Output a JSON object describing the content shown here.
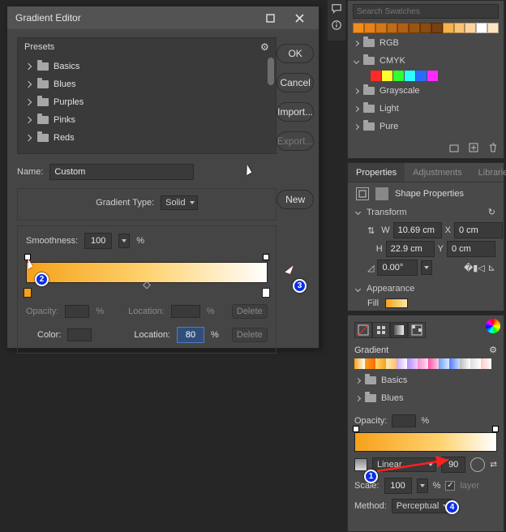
{
  "dialog": {
    "title": "Gradient Editor",
    "presets_label": "Presets",
    "preset_folders": [
      "Basics",
      "Blues",
      "Purples",
      "Pinks",
      "Reds"
    ],
    "buttons": {
      "ok": "OK",
      "cancel": "Cancel",
      "import": "Import...",
      "export": "Export...",
      "new": "New"
    },
    "name_label": "Name:",
    "name_value": "Custom",
    "gradient_type_label": "Gradient Type:",
    "gradient_type_value": "Solid",
    "smoothness_label": "Smoothness:",
    "smoothness_value": "100",
    "percent": "%",
    "stops": {
      "opacity_label": "Opacity:",
      "location_label": "Location:",
      "color_label": "Color:",
      "location_value": "80",
      "delete_label": "Delete"
    }
  },
  "swatches": {
    "search_placeholder": "Search Swatches",
    "top_colors": [
      "#f28c1b",
      "#e68219",
      "#d47717",
      "#c06b15",
      "#ae6013",
      "#9b5511",
      "#8a4b10",
      "#78400e",
      "#f7b24c",
      "#fac374",
      "#fdd59b",
      "#fff",
      "#ffe6c2"
    ],
    "folders": {
      "rgb": "RGB",
      "cmyk": "CMYK",
      "grayscale": "Grayscale",
      "light": "Light",
      "pure": "Pure"
    },
    "cmyk_colors": [
      "#ff2a2a",
      "#ffff2a",
      "#2fff2f",
      "#2affff",
      "#2a6bff",
      "#ff2aff"
    ]
  },
  "properties": {
    "tabs": [
      "Properties",
      "Adjustments",
      "Libraries"
    ],
    "shape_properties": "Shape Properties",
    "transform_label": "Transform",
    "w_label": "W",
    "w_value": "10.69 cm",
    "h_label": "H",
    "h_value": "22.9 cm",
    "x_label": "X",
    "x_value": "0 cm",
    "y_label": "Y",
    "y_value": "0 cm",
    "angle_value": "0.00°",
    "appearance_label": "Appearance",
    "fill_label": "Fill"
  },
  "gradient_panel": {
    "label": "Gradient",
    "preset_gradients": [
      "linear-gradient(to right,#f6a11a,#fff)",
      "linear-gradient(to right,#f6a11a,#ff6a00)",
      "linear-gradient(to right,#ffd86f,#f6a11a)",
      "linear-gradient(to right,#ffe8b8,#ffc562)",
      "linear-gradient(to right,#cfa3ff,#fff)",
      "linear-gradient(to right,#b08cff,#f0d0ff)",
      "linear-gradient(to right,#ff8ad1,#ffe0f2)",
      "linear-gradient(to right,#ff4fa3,#ffd0e8)",
      "linear-gradient(to right,#6aa3ff,#dce9ff)",
      "linear-gradient(to right,#4f7dff,#cddcff)",
      "linear-gradient(to right,#bbb,#fff)",
      "linear-gradient(to right,#ddd,#fff)",
      "linear-gradient(to right,#ffc9c0,#fff)"
    ],
    "folders": [
      "Basics",
      "Blues"
    ],
    "opacity_label": "Opacity:",
    "percent": "%",
    "linear_label": "Linear",
    "angle_value": "90",
    "scale_label": "Scale:",
    "scale_value": "100",
    "align_label": "layer",
    "method_label": "Method:",
    "method_value": "Perceptual"
  },
  "annotations": {
    "m1": "1",
    "m2": "2",
    "m3": "3",
    "m4": "4"
  }
}
